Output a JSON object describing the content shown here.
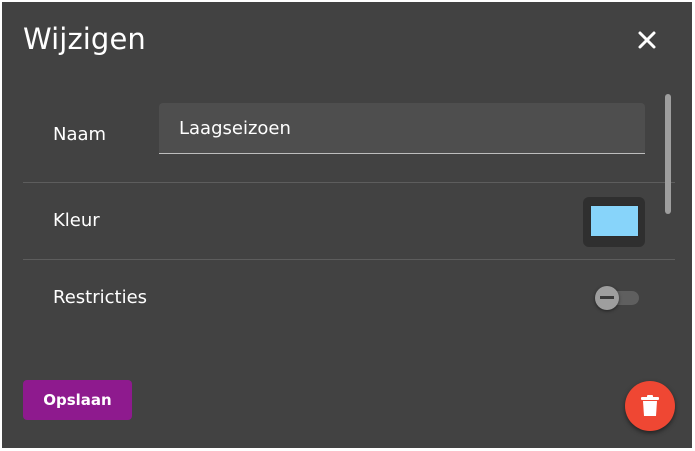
{
  "dialog": {
    "title": "Wijzigen",
    "close_icon": "close-icon"
  },
  "fields": {
    "name": {
      "label": "Naam",
      "value": "Laagseizoen"
    },
    "color": {
      "label": "Kleur",
      "value": "#87d4fa"
    },
    "restrictions": {
      "label": "Restricties",
      "enabled": false
    }
  },
  "footer": {
    "save_label": "Opslaan",
    "delete_icon": "trash-icon"
  },
  "colors": {
    "background": "#424242",
    "save_button": "#8e1a8e",
    "delete_button": "#ef4733"
  }
}
